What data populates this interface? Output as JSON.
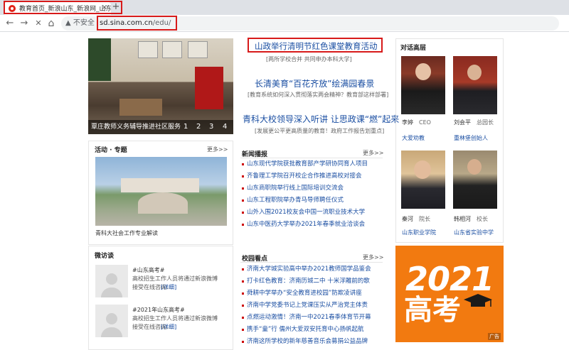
{
  "browser": {
    "tab_title": "教育首页_新浪山东_新浪网_山东",
    "tab_close": "×",
    "new_tab": "+",
    "back": "←",
    "forward": "→",
    "stop": "✕",
    "home": "⌂",
    "security_text": "▲ 不安全",
    "url_host": "sd.sina.com.cn",
    "url_path": "/edu/"
  },
  "slideshow": {
    "caption": "覃庄教师义务辅导推进社区服务",
    "pages": [
      "1",
      "2",
      "3",
      "4"
    ]
  },
  "headlines": [
    {
      "title": "山政举行清明节红色课堂教育活动",
      "sub": "[两所学校合并 共同申办本科大学]"
    },
    {
      "title": "长清美育“百花齐放”绘满园春景",
      "sub": "[教育系统如何深入贯彻落实两会精神？教育部这样部署]"
    },
    {
      "title": "青科大校领导深入听讲 让思政课“燃”起来",
      "sub": "[发展更公平更高质量的教育！政府工作报告划重点]"
    }
  ],
  "activities": {
    "title": "活动 · 专题",
    "more": "更多>>",
    "caption": "青科大社会工作专业解读"
  },
  "news": {
    "title": "新闻播报",
    "more": "更多>>",
    "items": [
      "山东现代学院获批教育部产学研协同育人项目",
      "齐鲁理工学院召开校企合作推进高校对接会",
      "山东商职院举行线上国际培训交流会",
      "山东工程职院举办青马导师聘任仪式",
      "山外入围2021校友会中国一流职业技术大学",
      "山东中医药大学举办2021年春季就业洽谈会"
    ]
  },
  "interview": {
    "title": "微访谈",
    "items": [
      {
        "tag": "#山东高考#",
        "text": "高校招生工作人员将通过新浪微博接受在线咨询...",
        "more": "[详细]"
      },
      {
        "tag": "#2021年山东高考#",
        "text": "高校招生工作人员将通过新浪微博接受在线咨询...",
        "more": "[详细]"
      }
    ]
  },
  "campus": {
    "title": "校园看点",
    "more": "更多>>",
    "items": [
      "济南大学城实验高中举办2021教师国学品鉴会",
      "打卡红色教育：济南历城二中 十米浮雕前的歌",
      "舜耕中学举办“安全教育进校园”防欺凌讲座",
      "济南中学党委书记上党课压实从严治党主体责",
      "点燃运动激情！济南一中2021春季体育节开幕",
      "携手“童”行 儒州大爱双安托育中心扬帆起航",
      "济南这所学校的新年慈善音乐会募捐公益品牌"
    ]
  },
  "dialogue": {
    "title": "对话高层",
    "people": [
      {
        "name": "李婷",
        "role": "CEO",
        "org": "大爱劝教"
      },
      {
        "name": "刘会平",
        "role": "总园长",
        "org": "重林堡创始人"
      },
      {
        "name": "秦河",
        "role": "院长",
        "org": "山东职业学院"
      },
      {
        "name": "韩相河",
        "role": "校长",
        "org": "山东省实验中学"
      }
    ]
  },
  "ad": {
    "year": "2021",
    "text": "高考",
    "label": "广告"
  },
  "colors": {
    "link": "#1a4ea2",
    "highlight_box": "#d71a1a",
    "ad_orange": "#f27a10"
  }
}
